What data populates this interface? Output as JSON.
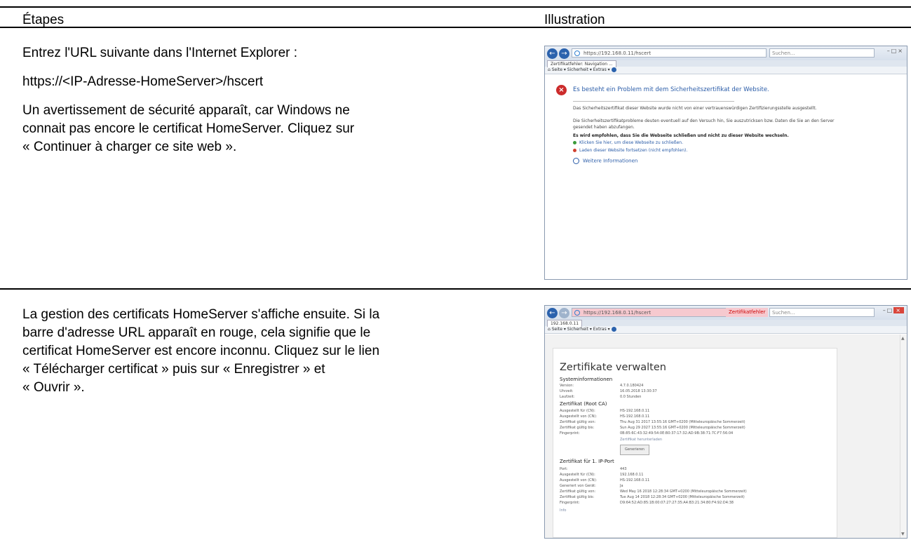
{
  "headers": {
    "steps": "Étapes",
    "illustration": "Illustration"
  },
  "step1": {
    "p1": "Entrez l'URL suivante dans l'Internet Explorer :",
    "p2": "https://<IP-Adresse-HomeServer>/hscert",
    "p3_lines": [
      "Un avertissement de sécurité apparaît, car Windows ne",
      "connait pas encore le certificat HomeServer. Cliquez sur",
      "« Continuer à charger ce site web »."
    ]
  },
  "step2": {
    "lines": [
      "La gestion des certificats HomeServer s'affiche ensuite. Si la",
      "barre d'adresse URL apparaît en rouge, cela signifie que le",
      "certificat HomeServer est encore inconnu. Cliquez sur le lien",
      "« Télécharger certificat » puis sur « Enregistrer » et",
      "« Ouvrir »."
    ]
  },
  "shot1": {
    "url": "https://192.168.0.11/hscert",
    "search": "Suchen...",
    "tab": "Zertifikatfehler: Navigation ...",
    "toolbar": "Seite ▾  Sicherheit ▾  Extras ▾",
    "warn_title": "Es besteht ein Problem mit dem Sicherheitszertifikat der Website.",
    "par1": "Das Sicherheitszertifikat dieser Website wurde nicht von einer vertrauenswürdigen Zertifizierungsstelle ausgestellt.",
    "par2": "Die Sicherheitszertifikatprobleme deuten eventuell auf den Versuch hin, Sie auszutricksen bzw. Daten die Sie an den Server gesendet haben abzufangen.",
    "par3": "Es wird empfohlen, dass Sie die Webseite schließen und nicht zu dieser Website wechseln.",
    "link1": "Klicken Sie hier, um diese Webseite zu schließen.",
    "link2": "Laden dieser Website fortsetzen (nicht empfohlen).",
    "more": "Weitere Informationen",
    "colors": {
      "icon": "#cc2b2b",
      "link": "#2a5ca8",
      "green_dot": "#3a9a3a",
      "red_dot": "#d0402f"
    }
  },
  "shot2": {
    "url": "https://192.168.0.11/hscert",
    "cert_error": "Zertifikatfehler",
    "search": "Suchen...",
    "tab": "192.168.0.11",
    "toolbar": "Seite ▾  Sicherheit ▾  Extras ▾",
    "title": "Zertifikate verwalten",
    "sys_heading": "Systeminformationen",
    "sys_rows": [
      [
        "Version:",
        "4.7.0.180424"
      ],
      [
        "Uhrzeit:",
        "16.05.2018 13:30:37"
      ],
      [
        "Laufzeit:",
        "0.0 Stunden"
      ]
    ],
    "root_heading": "Zertifikat (Root CA)",
    "root_rows": [
      [
        "Ausgestellt für (CN):",
        "HS-192.168.0.11"
      ],
      [
        "Ausgestellt von (CN):",
        "HS-192.168.0.11"
      ],
      [
        "Zertifikat gültig von:",
        "Thu Aug 31 2017 13:55:16 GMT+0200 (Mitteleuropäische Sommerzeit)"
      ],
      [
        "Zertifikat gültig bis:",
        "Sun Aug 29 2027 13:55:16 GMT+0200 (Mitteleuropäische Sommerzeit)"
      ],
      [
        "Fingerprint:",
        "0B:85:6C:43:32:49:54:0E:B0:37:17:32:AD:9B:38:71:7C:F7:56:04"
      ]
    ],
    "download_link": "Zertifikat herunterladen",
    "generate": "Generieren",
    "port_heading": "Zertifikat für 1. IP-Port",
    "port_rows": [
      [
        "Port:",
        "443"
      ],
      [
        "Ausgestellt für (CN):",
        "192.168.0.11"
      ],
      [
        "Ausgestellt von (CN):",
        "HS-192.168.0.11"
      ],
      [
        "Generiert von Gerät:",
        "Ja"
      ],
      [
        "Zertifikat gültig von:",
        "Wed May 16 2018 12:28:34 GMT+0200 (Mitteleuropäische Sommerzeit)"
      ],
      [
        "Zertifikat gültig bis:",
        "Tue Aug 14 2018 12:28:34 GMT+0200 (Mitteleuropäische Sommerzeit)"
      ],
      [
        "Fingerprint:",
        "D9:64:52:AD:85:1B:00:07:27:27:35:A4:B3:21:34:80:F4:92:D4:38"
      ]
    ],
    "more_link": "Info"
  }
}
